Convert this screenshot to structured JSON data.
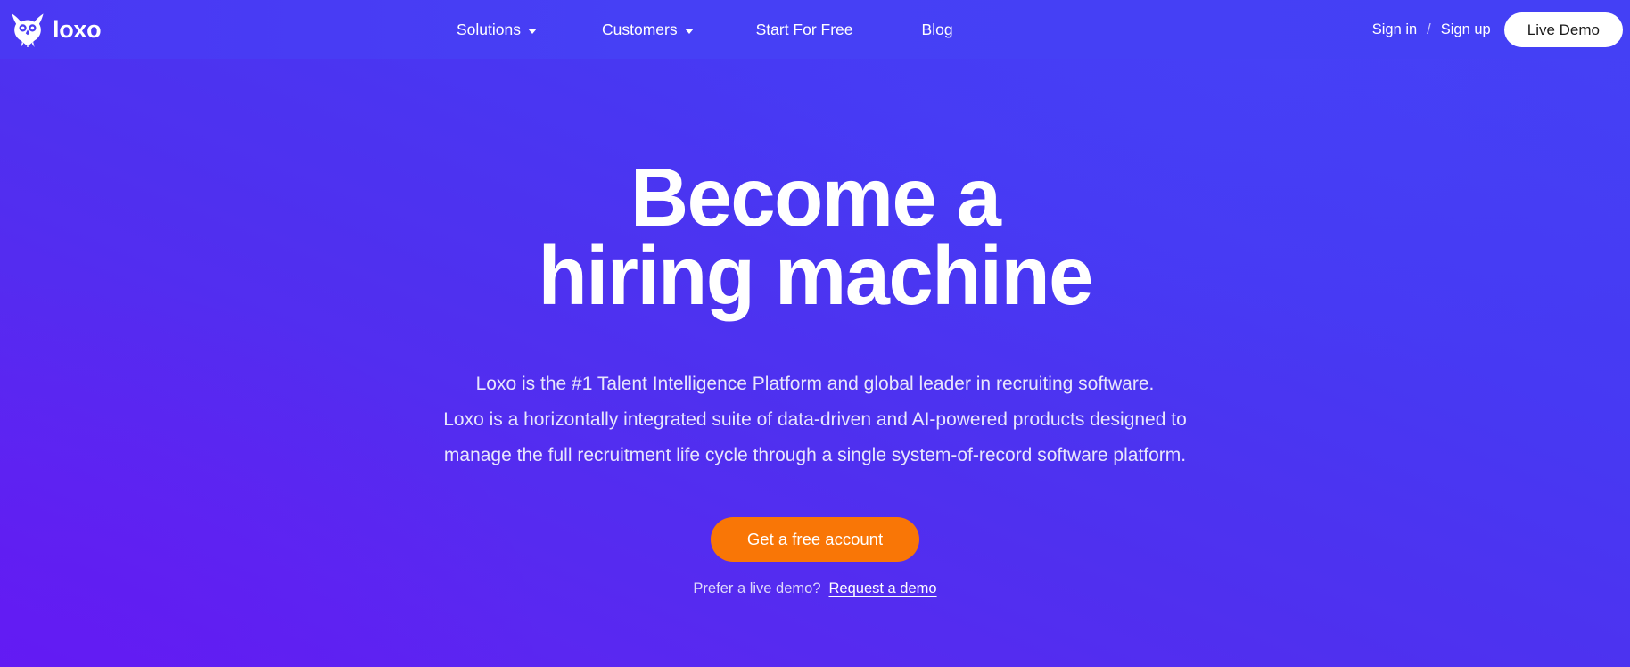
{
  "brand": {
    "name": "loxo",
    "logo_icon": "owl-icon"
  },
  "nav": {
    "items": [
      {
        "label": "Solutions",
        "has_dropdown": true,
        "icon": "chevron-down-icon"
      },
      {
        "label": "Customers",
        "has_dropdown": true,
        "icon": "chevron-down-icon"
      },
      {
        "label": "Start For Free",
        "has_dropdown": false
      },
      {
        "label": "Blog",
        "has_dropdown": false
      }
    ],
    "sign_in": "Sign in",
    "separator": "/",
    "sign_up": "Sign up",
    "live_demo": "Live Demo"
  },
  "hero": {
    "headline_line1": "Become a",
    "headline_line2": "hiring machine",
    "paragraph_line1": "Loxo is the #1 Talent Intelligence Platform and global leader in recruiting software.",
    "paragraph_line2": "Loxo is a horizontally integrated suite of data-driven and AI-powered products designed to",
    "paragraph_line3": "manage the full recruitment life cycle through a single system-of-record software platform.",
    "cta_label": "Get a free account",
    "demo_prompt": "Prefer a live demo?",
    "demo_link": "Request a demo"
  },
  "colors": {
    "background_start": "#5f1ef2",
    "background_end": "#4440f4",
    "navbar": "#4440f5",
    "cta_orange": "#f97606",
    "text_primary": "#ffffff",
    "text_muted": "#e8e6fd"
  }
}
